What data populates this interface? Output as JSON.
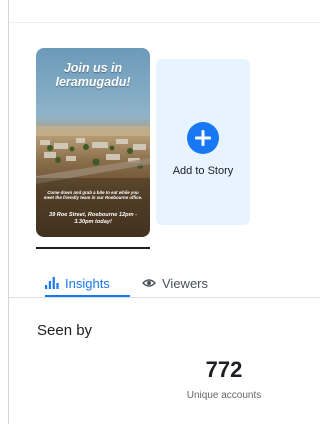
{
  "story": {
    "headline": "Join us in Ieramugadu!",
    "body": "Come down and grab a bite to eat while you meet the friendly team in our Roebourne office.",
    "address": "39 Roe Street, Roebourne 12pm - 3.30pm today!"
  },
  "add_story": {
    "label": "Add to Story",
    "icon": "plus-circle-icon"
  },
  "tabs": [
    {
      "label": "Insights",
      "icon": "bar-chart-icon",
      "active": true
    },
    {
      "label": "Viewers",
      "icon": "eye-icon",
      "active": false
    }
  ],
  "insights": {
    "heading": "Seen by",
    "count": "772",
    "caption": "Unique accounts"
  },
  "colors": {
    "accent": "#1877f2",
    "add_card_bg": "#e7f3ff",
    "text": "#1c1e21",
    "muted": "#65676b"
  }
}
